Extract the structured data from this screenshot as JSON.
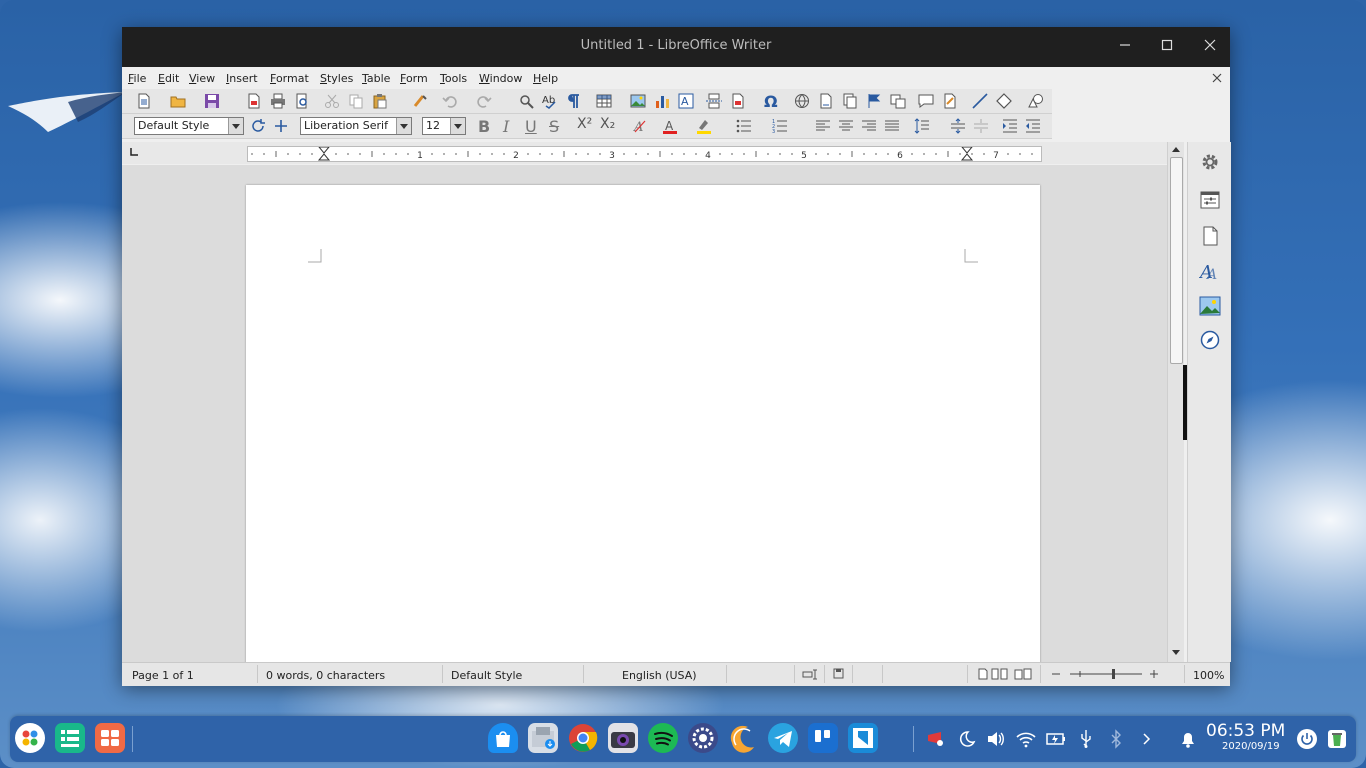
{
  "window": {
    "title": "Untitled 1 - LibreOffice Writer",
    "minimize_icon": "minimize-icon",
    "maximize_icon": "maximize-icon",
    "close_icon": "close-icon"
  },
  "menu": {
    "items": [
      {
        "label": "File",
        "key": "F",
        "rest": "ile"
      },
      {
        "label": "Edit",
        "key": "E",
        "rest": "dit"
      },
      {
        "label": "View",
        "key": "V",
        "rest": "iew"
      },
      {
        "label": "Insert",
        "key": "I",
        "rest": "nsert"
      },
      {
        "label": "Format",
        "key": "F",
        "rest": "ormat"
      },
      {
        "label": "Styles",
        "key": "S",
        "rest": "tyles"
      },
      {
        "label": "Table",
        "key": "T",
        "rest": "able"
      },
      {
        "label": "Form",
        "key": "F",
        "rest": "orm"
      },
      {
        "label": "Tools",
        "key": "T",
        "rest": "ools"
      },
      {
        "label": "Window",
        "key": "W",
        "rest": "indow"
      },
      {
        "label": "Help",
        "key": "H",
        "rest": "elp"
      }
    ],
    "close_document_icon": "close-icon"
  },
  "formatting": {
    "paragraph_style": "Default Style",
    "font_name": "Liberation Serif",
    "font_size": "12",
    "bold": "B",
    "italic": "I",
    "underline": "U",
    "strikethrough": "S",
    "superscript": "X²",
    "subscript": "X₂"
  },
  "ruler": {
    "numbers": [
      "1",
      "2",
      "3",
      "4",
      "5",
      "6",
      "7"
    ]
  },
  "statusbar": {
    "page": "Page 1 of 1",
    "words": "0 words, 0 characters",
    "style": "Default Style",
    "language": "English (USA)",
    "zoom": "100%"
  },
  "taskbar": {
    "time": "06:53 PM",
    "date": "2020/09/19"
  },
  "colors": {
    "font_color": "#e02020",
    "highlight_color": "#ffd800",
    "accent": "#2f63a9"
  }
}
